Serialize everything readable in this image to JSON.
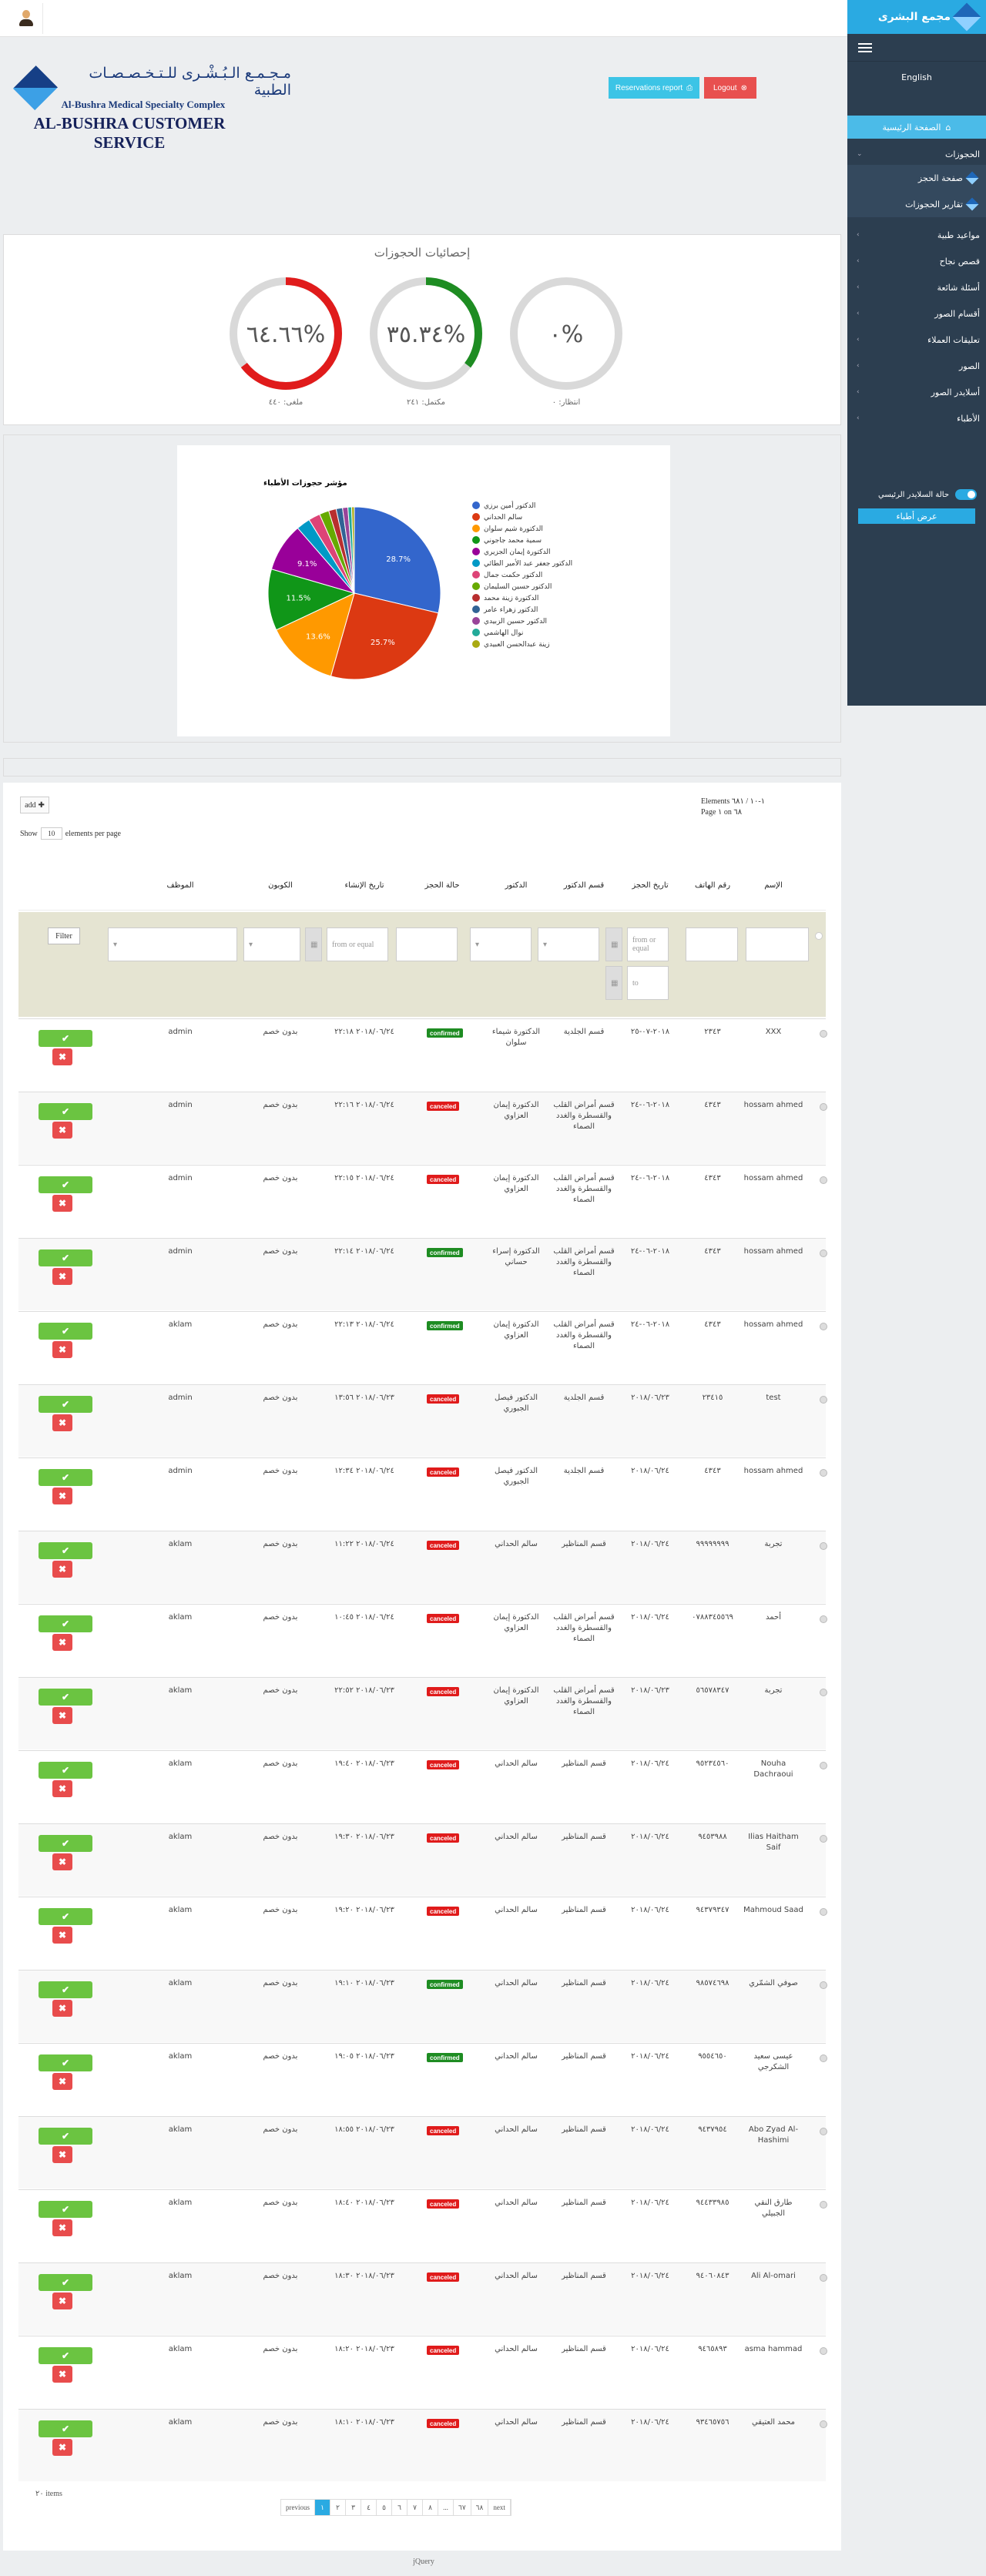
{
  "sidebar": {
    "brand": "مجمع البشرى",
    "language": "English",
    "home": "الصفحة الرئيسية",
    "section_bookings": "الحجوزات",
    "sub_booking_page": "صفحة الحجز",
    "sub_booking_reports": "تقارير الحجوزات",
    "items": [
      "مواعيد طبية",
      "قصص نجاح",
      "أسئلة شائعة",
      "أقسام الصور",
      "تعليقات العملاء",
      "الصور",
      "أسلايدر الصور",
      "الأطباء"
    ],
    "toggle_label": "حالة السلايدر الرئيسي",
    "doctors_button": "عرض أطباء"
  },
  "header": {
    "brand_ar": "مـجـمـع الـبُـشْـرى للـتـخـصـصـات الطبية",
    "brand_en": "Al-Bushra Medical Specialty Complex",
    "title": "AL-BUSHRA CUSTOMER SERVICE",
    "reservations_button": "Reservations report",
    "logout_button": "Logout"
  },
  "stats": {
    "title": "إحصائيات الحجوزات",
    "gauges": [
      {
        "value_text": "٦٤.٦٦%",
        "fraction": 0.6466,
        "label": "ملغى: ٤٤٠",
        "color": "#e01b1b"
      },
      {
        "value_text": "٣٥.٣٤%",
        "fraction": 0.3534,
        "label": "مكتمل: ٢٤١",
        "color": "#1e8c22"
      },
      {
        "value_text": "٠%",
        "fraction": 0,
        "label": "انتظار: ٠",
        "color": "#1e8c22"
      }
    ]
  },
  "chart_data": {
    "type": "pie",
    "title": "مؤشر حجوزات الأطباء",
    "categories": [
      "الدكتور أمين برزي",
      "سالم الحداني",
      "الدكتورة شيم سلوان",
      "سمية محمد جاجوني",
      "الدكتورة إيمان الجزيري",
      "الدكتور جعفر عبد الأمير الطائي",
      "الدكتور حكمت جمال",
      "الدكتور حسين السليمان",
      "الدكتورة زينة محمد",
      "الدكتور زهراء عامر",
      "الدكتور حسين الزبيدي",
      "نوال الهاشمي",
      "زينة عبدالحسن العبيدي"
    ],
    "values": [
      28.7,
      25.7,
      13.6,
      11.5,
      9.1,
      2.6,
      2.2,
      1.8,
      1.4,
      1.2,
      1.0,
      0.7,
      0.5
    ],
    "colors": [
      "#3366cc",
      "#dc3912",
      "#ff9900",
      "#109618",
      "#990099",
      "#0099c6",
      "#dd4477",
      "#66aa00",
      "#b82e2e",
      "#316395",
      "#994499",
      "#22aa99",
      "#aaaa11"
    ],
    "data_labels": [
      "28.7%",
      "25.7%",
      "13.6%",
      "11.5%",
      "9.1%"
    ],
    "legend": "right"
  },
  "table": {
    "add_label": "add",
    "show_label": "Show",
    "page_size": "10",
    "per_page_label": "elements per page",
    "elements_info": "Elements ١-١٠ / ٦٨١",
    "page_info": "Page ١ on ٦٨",
    "headers": [
      "الإسم",
      "رقم الهاتف",
      "تاريخ الحجز",
      "قسم الدكتور",
      "الدكتور",
      "حالة الحجز",
      "تاريخ الإنشاء",
      "الكوبون",
      "الموظف"
    ],
    "filter_button": "Filter",
    "from_placeholder": "from or equal",
    "to_placeholder": "to",
    "rows": [
      {
        "name": "XXX",
        "phone": "٢٣٤٣",
        "date": "٢٠١٨-٠٧-٢٥",
        "dept": "قسم الجلدية",
        "doctor": "الدكتورة شيماء سلوان",
        "status": "confirmed",
        "created": "٢٠١٨/٠٦/٢٤ ٢٢:١٨",
        "coupon": "بدون خصم",
        "employee": "admin"
      },
      {
        "name": "hossam ahmed",
        "phone": "٤٣٤٣",
        "date": "٢٠١٨-٠٦-٢٤",
        "dept": "قسم أمراض القلب والقسطرة والغدد الصماء",
        "doctor": "الدكتورة إيمان العزاوي",
        "status": "canceled",
        "created": "٢٠١٨/٠٦/٢٤ ٢٢:١٦",
        "coupon": "بدون خصم",
        "employee": "admin"
      },
      {
        "name": "hossam ahmed",
        "phone": "٤٣٤٣",
        "date": "٢٠١٨-٠٦-٢٤",
        "dept": "قسم أمراض القلب والقسطرة والغدد الصماء",
        "doctor": "الدكتورة إيمان العزاوي",
        "status": "canceled",
        "created": "٢٠١٨/٠٦/٢٤ ٢٢:١٥",
        "coupon": "بدون خصم",
        "employee": "admin"
      },
      {
        "name": "hossam ahmed",
        "phone": "٤٣٤٣",
        "date": "٢٠١٨-٠٦-٢٤",
        "dept": "قسم أمراض القلب والقسطرة والغدد الصماء",
        "doctor": "الدكتورة إسراء حساني",
        "status": "confirmed",
        "created": "٢٠١٨/٠٦/٢٤ ٢٢:١٤",
        "coupon": "بدون خصم",
        "employee": "admin"
      },
      {
        "name": "hossam ahmed",
        "phone": "٤٣٤٣",
        "date": "٢٠١٨-٠٦-٢٤",
        "dept": "قسم أمراض القلب والقسطرة والغدد الصماء",
        "doctor": "الدكتورة إيمان العزاوي",
        "status": "confirmed",
        "created": "٢٠١٨/٠٦/٢٤ ٢٢:١٣",
        "coupon": "بدون خصم",
        "employee": "aklam"
      },
      {
        "name": "test",
        "phone": "٢٣٤١٥",
        "date": "٢٠١٨/٠٦/٢٣",
        "dept": "قسم الجلدية",
        "doctor": "الدكتور فيصل الجبوري",
        "status": "canceled",
        "created": "٢٠١٨/٠٦/٢٣ ١٣:٥٦",
        "coupon": "بدون خصم",
        "employee": "admin"
      },
      {
        "name": "hossam ahmed",
        "phone": "٤٣٤٣",
        "date": "٢٠١٨/٠٦/٢٤",
        "dept": "قسم الجلدية",
        "doctor": "الدكتور فيصل الجبوري",
        "status": "canceled",
        "created": "٢٠١٨/٠٦/٢٤ ١٢:٣٤",
        "coupon": "بدون خصم",
        "employee": "admin"
      },
      {
        "name": "تجربة",
        "phone": "٩٩٩٩٩٩٩٩",
        "date": "٢٠١٨/٠٦/٢٤",
        "dept": "قسم المناظير",
        "doctor": "سالم الحداني",
        "status": "canceled",
        "created": "٢٠١٨/٠٦/٢٤ ١١:٢٢",
        "coupon": "بدون خصم",
        "employee": "aklam"
      },
      {
        "name": "أحمد",
        "phone": "٠٧٨٨٣٤٥٥٦٩",
        "date": "٢٠١٨/٠٦/٢٤",
        "dept": "قسم أمراض القلب والقسطرة والغدد الصماء",
        "doctor": "الدكتورة إيمان العزاوي",
        "status": "canceled",
        "created": "٢٠١٨/٠٦/٢٤ ١٠:٤٥",
        "coupon": "بدون خصم",
        "employee": "aklam"
      },
      {
        "name": "تجربة",
        "phone": "٥٦٥٧٨٣٤٧",
        "date": "٢٠١٨/٠٦/٢٣",
        "dept": "قسم أمراض القلب والقسطرة والغدد الصماء",
        "doctor": "الدكتورة إيمان العزاوي",
        "status": "canceled",
        "created": "٢٠١٨/٠٦/٢٣ ٢٢:٥٢",
        "coupon": "بدون خصم",
        "employee": "aklam"
      },
      {
        "name": "Nouha Dachraoui",
        "phone": "٩٥٢٣٤٥٦٠",
        "date": "٢٠١٨/٠٦/٢٤",
        "dept": "قسم المناظير",
        "doctor": "سالم الحداني",
        "status": "canceled",
        "created": "٢٠١٨/٠٦/٢٣ ١٩:٤٠",
        "coupon": "بدون خصم",
        "employee": "aklam"
      },
      {
        "name": "Ilias Haitham Saif",
        "phone": "٩٤٥٣٩٨٨",
        "date": "٢٠١٨/٠٦/٢٤",
        "dept": "قسم المناظير",
        "doctor": "سالم الحداني",
        "status": "canceled",
        "created": "٢٠١٨/٠٦/٢٣ ١٩:٣٠",
        "coupon": "بدون خصم",
        "employee": "aklam"
      },
      {
        "name": "Mahmoud Saad",
        "phone": "٩٤٣٧٩٣٤٧",
        "date": "٢٠١٨/٠٦/٢٤",
        "dept": "قسم المناظير",
        "doctor": "سالم الحداني",
        "status": "canceled",
        "created": "٢٠١٨/٠٦/٢٣ ١٩:٢٠",
        "coupon": "بدون خصم",
        "employee": "aklam"
      },
      {
        "name": "صوفي الشمّري",
        "phone": "٩٨٥٧٤٦٩٨",
        "date": "٢٠١٨/٠٦/٢٤",
        "dept": "قسم المناظير",
        "doctor": "سالم الحداني",
        "status": "confirmed",
        "created": "٢٠١٨/٠٦/٢٣ ١٩:١٠",
        "coupon": "بدون خصم",
        "employee": "aklam"
      },
      {
        "name": "عيسى سعيد الشكرجي",
        "phone": "٩٥٥٤٦٥٠",
        "date": "٢٠١٨/٠٦/٢٤",
        "dept": "قسم المناظير",
        "doctor": "سالم الحداني",
        "status": "confirmed",
        "created": "٢٠١٨/٠٦/٢٣ ١٩:٠٥",
        "coupon": "بدون خصم",
        "employee": "aklam"
      },
      {
        "name": "Abo Zyad Al-Hashimi",
        "phone": "٩٤٣٧٩٥٤",
        "date": "٢٠١٨/٠٦/٢٤",
        "dept": "قسم المناظير",
        "doctor": "سالم الحداني",
        "status": "canceled",
        "created": "٢٠١٨/٠٦/٢٣ ١٨:٥٥",
        "coupon": "بدون خصم",
        "employee": "aklam"
      },
      {
        "name": "طارق النقي الجبيلي",
        "phone": "٩٤٤٣٣٩٨٥",
        "date": "٢٠١٨/٠٦/٢٤",
        "dept": "قسم المناظير",
        "doctor": "سالم الحداني",
        "status": "canceled",
        "created": "٢٠١٨/٠٦/٢٣ ١٨:٤٠",
        "coupon": "بدون خصم",
        "employee": "aklam"
      },
      {
        "name": "Ali Al-omari",
        "phone": "٩٤٠٦٠٨٤٣",
        "date": "٢٠١٨/٠٦/٢٤",
        "dept": "قسم المناظير",
        "doctor": "سالم الحداني",
        "status": "canceled",
        "created": "٢٠١٨/٠٦/٢٣ ١٨:٣٠",
        "coupon": "بدون خصم",
        "employee": "aklam"
      },
      {
        "name": "asma hammad",
        "phone": "٩٤٦٥٨٩٣",
        "date": "٢٠١٨/٠٦/٢٤",
        "dept": "قسم المناظير",
        "doctor": "سالم الحداني",
        "status": "canceled",
        "created": "٢٠١٨/٠٦/٢٣ ١٨:٢٠",
        "coupon": "بدون خصم",
        "employee": "aklam"
      },
      {
        "name": "محمد العتيقي",
        "phone": "٩٣٤٦٥٧٥٦",
        "date": "٢٠١٨/٠٦/٢٤",
        "dept": "قسم المناظير",
        "doctor": "سالم الحداني",
        "status": "canceled",
        "created": "٢٠١٨/٠٦/٢٣ ١٨:١٠",
        "coupon": "بدون خصم",
        "employee": "aklam"
      }
    ],
    "footer_count": "٢٠ items",
    "pager": [
      "previous",
      "١",
      "٢",
      "٣",
      "٤",
      "٥",
      "٦",
      "٧",
      "٨",
      "...",
      "٦٧",
      "٦٨",
      "next"
    ]
  },
  "footer": "jQuery",
  "colors": {
    "accent": "#2aaae2",
    "confirmed": "#1e8c22",
    "canceled": "#e01b1b",
    "ok": "#6bc441",
    "remove": "#e84c4c"
  }
}
